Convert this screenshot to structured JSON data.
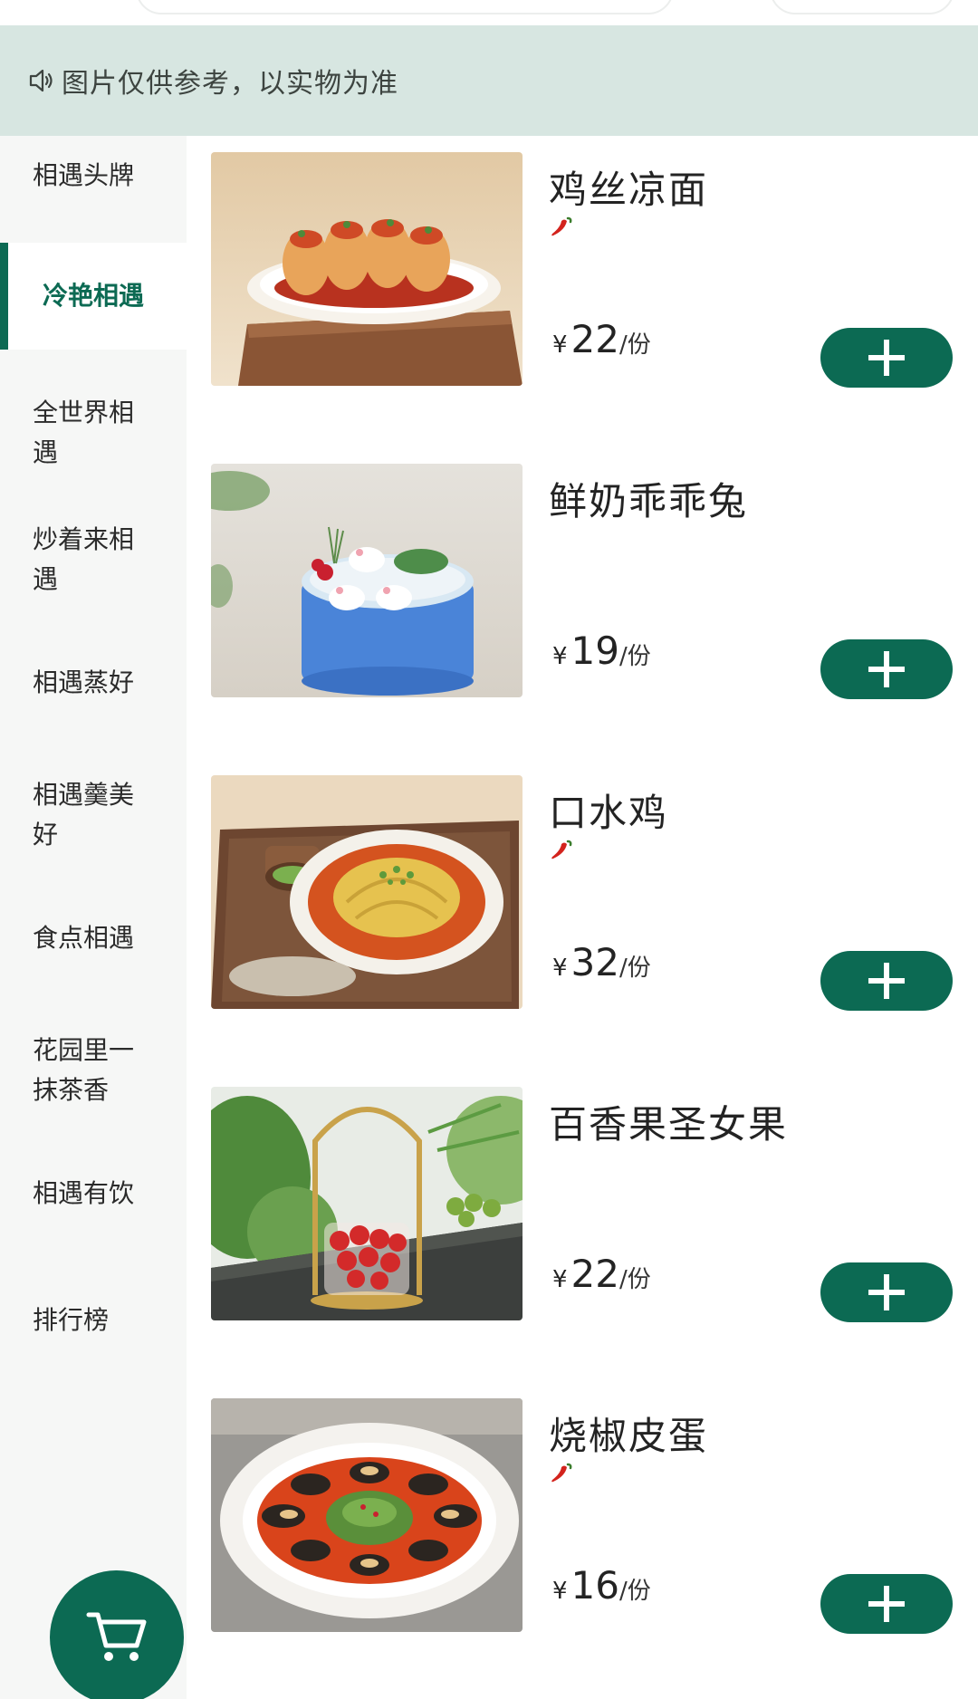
{
  "notice": {
    "icon": "speaker-icon",
    "text": "图片仅供参考，以实物为准"
  },
  "sidebar": {
    "items": [
      {
        "label": "相遇头牌",
        "active": false
      },
      {
        "label": "冷艳相遇",
        "active": true
      },
      {
        "label": "全世界相遇",
        "active": false
      },
      {
        "label": "炒着来相遇",
        "active": false
      },
      {
        "label": "相遇蒸好",
        "active": false
      },
      {
        "label": "相遇羹美好",
        "active": false
      },
      {
        "label": "食点相遇",
        "active": false
      },
      {
        "label": "花园里一抹茶香",
        "active": false
      },
      {
        "label": "相遇有饮",
        "active": false
      },
      {
        "label": "排行榜",
        "active": false
      }
    ]
  },
  "products": [
    {
      "name": "鸡丝凉面",
      "spicy": true,
      "currency": "¥",
      "price": "22",
      "unit": "/份"
    },
    {
      "name": "鲜奶乖乖兔",
      "spicy": false,
      "currency": "¥",
      "price": "19",
      "unit": "/份"
    },
    {
      "name": "口水鸡",
      "spicy": true,
      "currency": "¥",
      "price": "32",
      "unit": "/份"
    },
    {
      "name": "百香果圣女果",
      "spicy": false,
      "currency": "¥",
      "price": "22",
      "unit": "/份"
    },
    {
      "name": "烧椒皮蛋",
      "spicy": true,
      "currency": "¥",
      "price": "16",
      "unit": "/份"
    }
  ],
  "icons": {
    "add": "plus-icon",
    "spicy": "chili-pepper-icon",
    "cart": "shopping-cart-icon"
  },
  "colors": {
    "accent": "#0c6a53",
    "notice_bg": "#d7e6e1",
    "sidebar_bg": "#f6f7f6"
  }
}
